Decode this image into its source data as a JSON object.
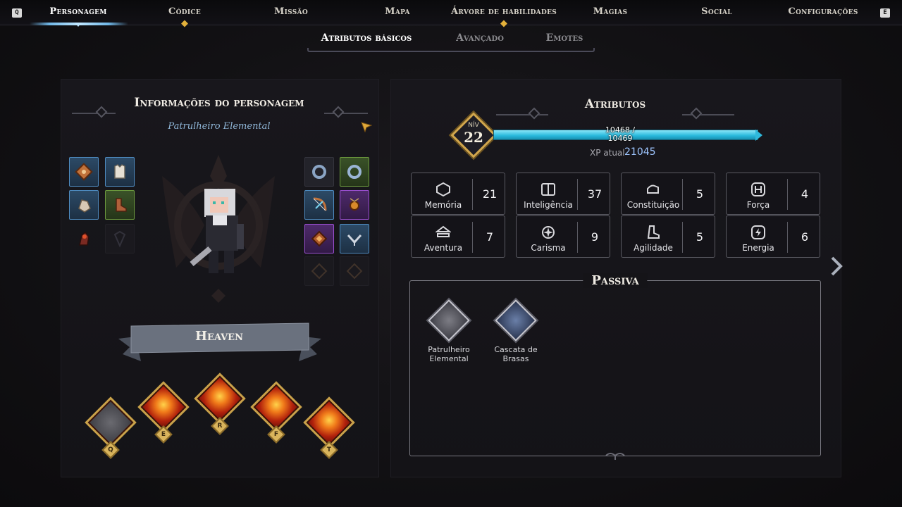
{
  "nav": {
    "left_key": "Q",
    "right_key": "E",
    "tabs": [
      {
        "label": "Personagem",
        "active": true,
        "notify": false
      },
      {
        "label": "Códice",
        "active": false,
        "notify": true
      },
      {
        "label": "Missão",
        "active": false,
        "notify": false
      },
      {
        "label": "Mapa",
        "active": false,
        "notify": false
      },
      {
        "label": "Árvore de habilidades",
        "active": false,
        "notify": true
      },
      {
        "label": "Magias",
        "active": false,
        "notify": false
      },
      {
        "label": "Social",
        "active": false,
        "notify": false
      },
      {
        "label": "Configurações",
        "active": false,
        "notify": false
      }
    ]
  },
  "subtabs": [
    {
      "label": "Atributos básicos",
      "active": true
    },
    {
      "label": "Avançado",
      "active": false
    },
    {
      "label": "Emotes",
      "active": false
    }
  ],
  "character_panel": {
    "title": "Informações do personagem",
    "class_name": "Patrulheiro Elemental",
    "player_name": "Heaven",
    "edit_icon": "edit-flag-icon",
    "equipment_left": [
      {
        "icon": "scroll-icon",
        "rarity": "blue"
      },
      {
        "icon": "chest-armor-icon",
        "rarity": "blue"
      },
      {
        "icon": "gloves-icon",
        "rarity": "blue"
      },
      {
        "icon": "boots-icon",
        "rarity": "green"
      },
      {
        "icon": "consumable-icon",
        "rarity": "none"
      },
      {
        "icon": "empty-shield-slot-icon",
        "rarity": "empty"
      }
    ],
    "equipment_right": [
      {
        "icon": "ring-icon",
        "rarity": "none"
      },
      {
        "icon": "ring-icon",
        "rarity": "green"
      },
      {
        "icon": "bow-icon",
        "rarity": "blue"
      },
      {
        "icon": "amulet-icon",
        "rarity": "purple"
      },
      {
        "icon": "tome-icon",
        "rarity": "purple"
      },
      {
        "icon": "quiver-icon",
        "rarity": "blue"
      },
      {
        "icon": "empty-relic-slot-icon",
        "rarity": "empty"
      },
      {
        "icon": "empty-relic-slot-icon",
        "rarity": "empty"
      }
    ],
    "skills": [
      {
        "key": "Q",
        "icon": "arrow-shot-icon",
        "style": "arrow"
      },
      {
        "key": "E",
        "icon": "fireball-icon",
        "style": "fire"
      },
      {
        "key": "R",
        "icon": "meteor-icon",
        "style": "fire"
      },
      {
        "key": "F",
        "icon": "fire-dragon-icon",
        "style": "fire"
      },
      {
        "key": "T",
        "icon": "fire-vortex-icon",
        "style": "fire"
      }
    ]
  },
  "attributes_panel": {
    "title": "Atributos",
    "level_label": "NÍV",
    "level": "22",
    "xp_progress": "10468 / 10469",
    "xp_fraction": 0.9999,
    "xp_current_label": "XP atual",
    "xp_current_value": "21045",
    "stats": [
      {
        "name": "Memória",
        "value": "21",
        "icon": "memory-icon"
      },
      {
        "name": "Inteligência",
        "value": "37",
        "icon": "book-icon"
      },
      {
        "name": "Constituição",
        "value": "5",
        "icon": "arm-icon"
      },
      {
        "name": "Força",
        "value": "4",
        "icon": "strength-icon"
      },
      {
        "name": "Aventura",
        "value": "7",
        "icon": "adventure-icon"
      },
      {
        "name": "Carisma",
        "value": "9",
        "icon": "charisma-icon"
      },
      {
        "name": "Agilidade",
        "value": "5",
        "icon": "boot-icon"
      },
      {
        "name": "Energia",
        "value": "6",
        "icon": "energy-icon"
      }
    ],
    "passive_title": "Passiva",
    "passives": [
      {
        "name": "Patrulheiro Elemental",
        "icon": "ranger-emblem-icon",
        "style": "gray"
      },
      {
        "name": "Cascata de Brasas",
        "icon": "blue-flame-icon",
        "style": "blue"
      }
    ],
    "next_icon": "chevron-right-icon"
  }
}
